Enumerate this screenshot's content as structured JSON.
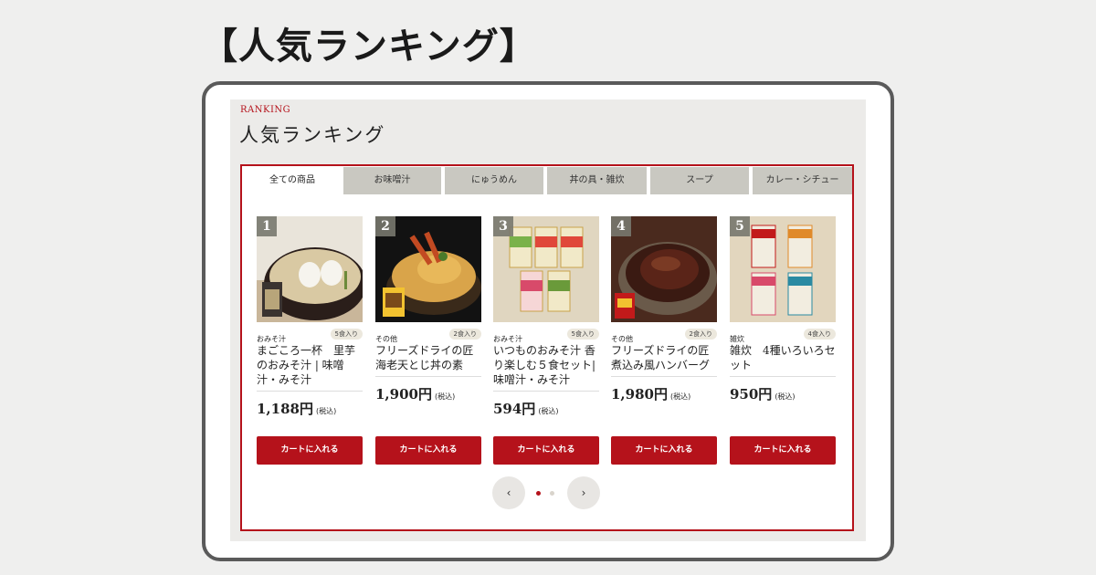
{
  "headline": "【人気ランキング】",
  "section": {
    "label": "RANKING",
    "title": "人気ランキング"
  },
  "tabs": [
    {
      "label": "全ての商品",
      "active": true
    },
    {
      "label": "お味噌汁",
      "active": false
    },
    {
      "label": "にゅうめん",
      "active": false
    },
    {
      "label": "丼の具・雑炊",
      "active": false
    },
    {
      "label": "スープ",
      "active": false
    },
    {
      "label": "カレー・シチュー",
      "active": false
    }
  ],
  "products": [
    {
      "rank": "1",
      "category": "おみそ汁",
      "quantity": "5食入り",
      "name": "まごころ一杯　里芋のおみそ汁 | 味噌汁・みそ汁",
      "price": "1,188円",
      "tax": "(税込)",
      "cart_label": "カートに入れる",
      "image_icon": "miso-soup-bowl-photo"
    },
    {
      "rank": "2",
      "category": "その他",
      "quantity": "2食入り",
      "name": "フリーズドライの匠 海老天とじ丼の素",
      "price": "1,900円",
      "tax": "(税込)",
      "cart_label": "カートに入れる",
      "image_icon": "tendon-bowl-photo"
    },
    {
      "rank": "3",
      "category": "おみそ汁",
      "quantity": "5食入り",
      "name": "いつものおみそ汁 香り楽しむ５食セット| 味噌汁・みそ汁",
      "price": "594円",
      "tax": "(税込)",
      "cart_label": "カートに入れる",
      "image_icon": "miso-soup-pack-set-photo"
    },
    {
      "rank": "4",
      "category": "その他",
      "quantity": "2食入り",
      "name": "フリーズドライの匠 煮込み風ハンバーグ",
      "price": "1,980円",
      "tax": "(税込)",
      "cart_label": "カートに入れる",
      "image_icon": "hamburg-steak-pot-photo"
    },
    {
      "rank": "5",
      "category": "雑炊",
      "quantity": "4食入り",
      "name": "雑炊　4種いろいろセット",
      "price": "950円",
      "tax": "(税込)",
      "cart_label": "カートに入れる",
      "image_icon": "zosui-pack-set-photo"
    }
  ],
  "pager": {
    "prev": "‹",
    "next": "›",
    "current_page": 1,
    "total_pages": 2
  },
  "colors": {
    "accent": "#b5121b",
    "tab_inactive": "#c9c8c1",
    "panel_bg": "#ecebe9"
  }
}
